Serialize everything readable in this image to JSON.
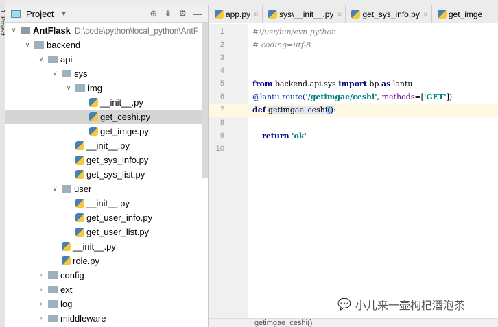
{
  "side_strip": "1: Project",
  "project": {
    "title": "Project",
    "root": "AntFlask",
    "root_path": "D:\\code\\python\\local_python\\AntF",
    "tree": [
      {
        "label": "backend",
        "type": "folder",
        "level": 1,
        "open": true
      },
      {
        "label": "api",
        "type": "folder",
        "level": 2,
        "open": true
      },
      {
        "label": "sys",
        "type": "folder",
        "level": 3,
        "open": true
      },
      {
        "label": "img",
        "type": "folder",
        "level": 4,
        "open": true
      },
      {
        "label": "__init__.py",
        "type": "py",
        "level": 5
      },
      {
        "label": "get_ceshi.py",
        "type": "py",
        "level": 5,
        "selected": true
      },
      {
        "label": "get_imge.py",
        "type": "py",
        "level": 5
      },
      {
        "label": "__init__.py",
        "type": "py",
        "level": 4
      },
      {
        "label": "get_sys_info.py",
        "type": "py",
        "level": 4
      },
      {
        "label": "get_sys_list.py",
        "type": "py",
        "level": 4
      },
      {
        "label": "user",
        "type": "folder",
        "level": 3,
        "open": true
      },
      {
        "label": "__init__.py",
        "type": "py",
        "level": 4
      },
      {
        "label": "get_user_info.py",
        "type": "py",
        "level": 4
      },
      {
        "label": "get_user_list.py",
        "type": "py",
        "level": 4
      },
      {
        "label": "__init__.py",
        "type": "py",
        "level": 3
      },
      {
        "label": "role.py",
        "type": "py",
        "level": 3
      },
      {
        "label": "config",
        "type": "folder",
        "level": 2,
        "open": false
      },
      {
        "label": "ext",
        "type": "folder",
        "level": 2,
        "open": false
      },
      {
        "label": "log",
        "type": "folder",
        "level": 2,
        "open": false
      },
      {
        "label": "middleware",
        "type": "folder",
        "level": 2,
        "open": false
      }
    ]
  },
  "tabs": [
    "app.py",
    "sys\\__init__.py",
    "get_sys_info.py",
    "get_imge"
  ],
  "code": {
    "l1": "#!/usr/bin/evn python",
    "l2": "# coding=utf-8",
    "from": "from",
    "mod": " backend.api.sys ",
    "import": "import",
    "bp": " bp ",
    "as": "as",
    "lantu": " lantu",
    "deco": "@lantu.route(",
    "route": "'/getimgae/ceshi'",
    "comma": ", ",
    "methods": "methods",
    "eq": "=[",
    "get": "'GET'",
    "close": "])",
    "def": "def",
    "fname": "getimgae_ceshi",
    "parens": "()",
    "colon": ":",
    "ret": "return",
    "ok": "'ok'"
  },
  "line_numbers": [
    "1",
    "2",
    "3",
    "4",
    "5",
    "6",
    "7",
    "8",
    "9",
    "10"
  ],
  "status": "getimgae_ceshi()",
  "watermark": "小儿来一壶枸杞酒泡茶"
}
